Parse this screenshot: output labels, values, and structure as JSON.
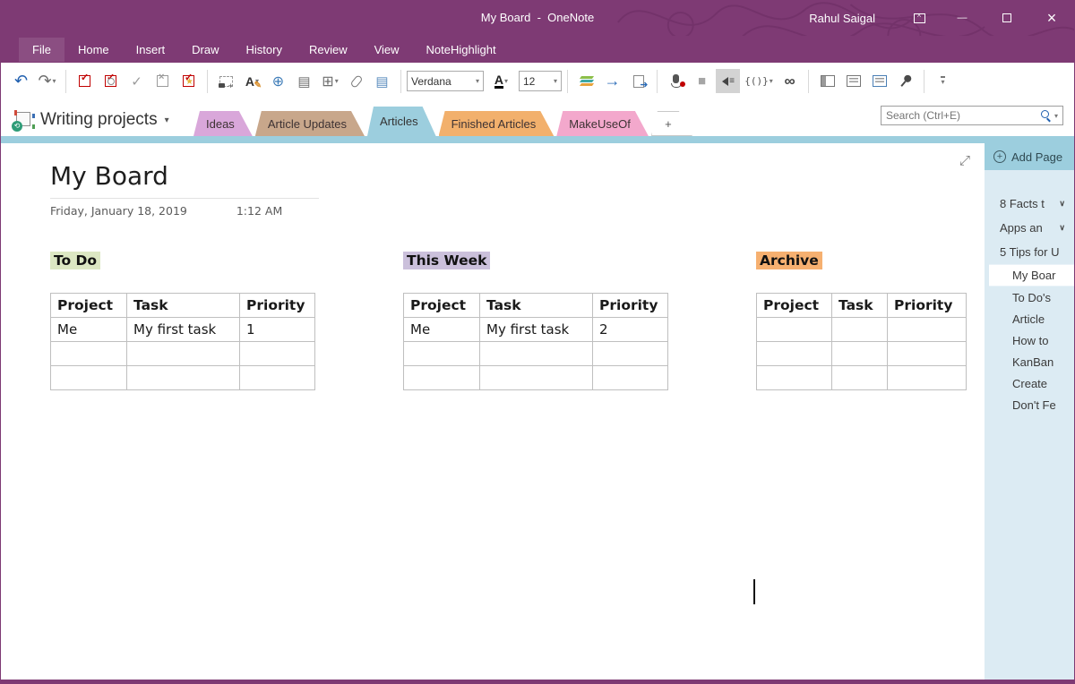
{
  "window": {
    "title": "My Board  -  OneNote",
    "user": "Rahul Saigal"
  },
  "colors": {
    "titlebar": "#7E3A74",
    "accent_blue": "#9CCEDE",
    "panel": "#DCEBF3",
    "tab_ideas": "#D9A7DA",
    "tab_article_updates": "#C8A78B",
    "tab_articles": "#9CCEDE",
    "tab_finished": "#F2B06C",
    "tab_makeuseof": "#F3A8CC",
    "highlight_todo": "#DCE7C3",
    "highlight_week": "#CBC0DB",
    "highlight_archive": "#F6B070"
  },
  "menu": {
    "items": [
      "File",
      "Home",
      "Insert",
      "Draw",
      "History",
      "Review",
      "View",
      "NoteHighlight"
    ]
  },
  "toolbar": {
    "font_name": "Verdana",
    "font_size": "12",
    "font_color_letter": "A",
    "style_letter": "A",
    "snippet_label": "{()}"
  },
  "icons": {
    "undo": "↶",
    "redo": "↷",
    "dropdown": "▾",
    "check": "✓",
    "cross": "×",
    "plus": "+",
    "link": "⊕",
    "file": "▤",
    "table": "⊞",
    "forward": "→",
    "stop": "■",
    "speaker_bars": "≡",
    "infinity": "∞",
    "pencil": "✎",
    "expand": "⤢",
    "chevron_down": "∨",
    "sync": "⟲",
    "minimize": "—",
    "more": "▾",
    "ribbon_caret": "^"
  },
  "notebook": {
    "name": "Writing projects"
  },
  "tabs": [
    {
      "label": "Ideas"
    },
    {
      "label": "Article Updates"
    },
    {
      "label": "Articles",
      "active": true
    },
    {
      "label": "Finished Articles"
    },
    {
      "label": "MakeUseOf"
    },
    {
      "label": "+"
    }
  ],
  "search": {
    "placeholder": "Search (Ctrl+E)"
  },
  "page": {
    "title": "My Board",
    "date": "Friday, January 18, 2019",
    "time": "1:12 AM"
  },
  "sections": [
    {
      "heading": "To Do",
      "headers": [
        "Project",
        "Task",
        "Priority"
      ],
      "rows": [
        [
          "Me",
          "My first task",
          "1"
        ],
        [
          "",
          "",
          ""
        ],
        [
          "",
          "",
          ""
        ]
      ]
    },
    {
      "heading": "This Week",
      "headers": [
        "Project",
        "Task",
        "Priority"
      ],
      "rows": [
        [
          "Me",
          "My first task",
          "2"
        ],
        [
          "",
          "",
          ""
        ],
        [
          "",
          "",
          ""
        ]
      ]
    },
    {
      "heading": "Archive",
      "headers": [
        "Project",
        "Task",
        "Priority"
      ],
      "rows": [
        [
          "",
          "",
          ""
        ],
        [
          "",
          "",
          ""
        ],
        [
          "",
          "",
          ""
        ]
      ]
    }
  ],
  "sidebar": {
    "add_page": "Add Page",
    "pages": [
      {
        "label": "8 Facts t",
        "chevron": true
      },
      {
        "label": "Apps an",
        "chevron": true
      },
      {
        "label": "5 Tips for U"
      },
      {
        "label": "My Boar",
        "selected": true
      },
      {
        "label": "To Do's"
      },
      {
        "label": "Article"
      },
      {
        "label": "How to"
      },
      {
        "label": "KanBan"
      },
      {
        "label": "Create"
      },
      {
        "label": "Don't Fe"
      }
    ]
  }
}
